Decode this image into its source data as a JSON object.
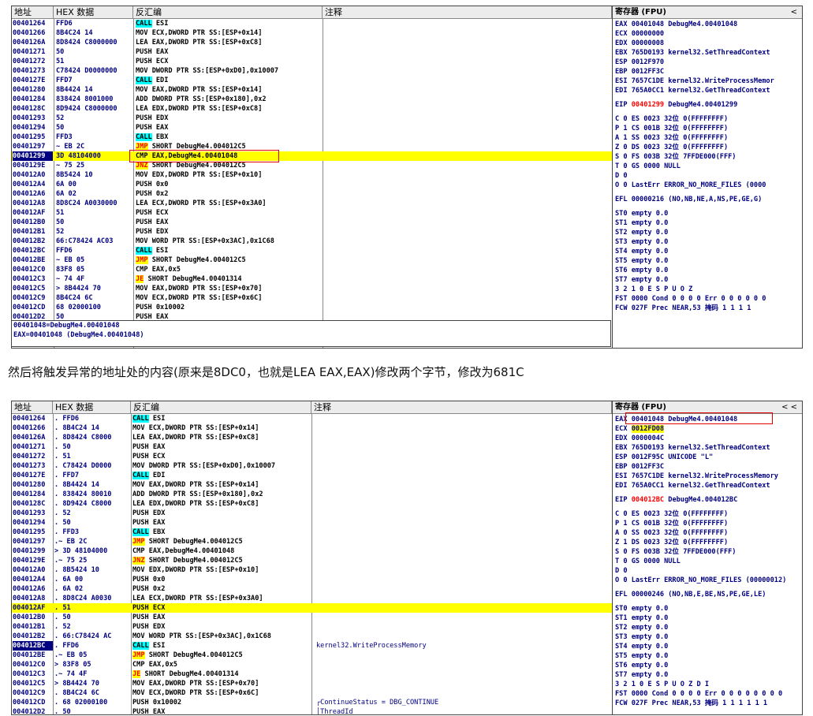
{
  "top": {
    "headers": {
      "addr": "地址",
      "hex": "HEX 数据",
      "dis": "反汇编",
      "cmt": "注释"
    },
    "rows": [
      {
        "addr": "00401264",
        "hex": "FFD6",
        "kw": "CALL",
        "kind": "call",
        "rest": " ESI",
        "cmt": ""
      },
      {
        "addr": "00401266",
        "hex": "8B4C24 14",
        "kw": "",
        "kind": "",
        "rest": "MOV ECX,DWORD PTR SS:[ESP+0x14]",
        "cmt": ""
      },
      {
        "addr": "0040126A",
        "hex": "8D8424 C8000000",
        "kw": "",
        "kind": "",
        "rest": "LEA EAX,DWORD PTR SS:[ESP+0xC8]",
        "cmt": ""
      },
      {
        "addr": "00401271",
        "hex": "50",
        "kw": "",
        "kind": "",
        "rest": "PUSH EAX",
        "cmt": ""
      },
      {
        "addr": "00401272",
        "hex": "51",
        "kw": "",
        "kind": "",
        "rest": "PUSH ECX",
        "cmt": ""
      },
      {
        "addr": "00401273",
        "hex": "C78424 D0000000",
        "kw": "",
        "kind": "",
        "rest": "MOV DWORD PTR SS:[ESP+0xD0],0x10007",
        "cmt": ""
      },
      {
        "addr": "0040127E",
        "hex": "FFD7",
        "kw": "CALL",
        "kind": "call",
        "rest": " EDI",
        "cmt": ""
      },
      {
        "addr": "00401280",
        "hex": "8B4424 14",
        "kw": "",
        "kind": "",
        "rest": "MOV EAX,DWORD PTR SS:[ESP+0x14]",
        "cmt": ""
      },
      {
        "addr": "00401284",
        "hex": "838424 8001000",
        "kw": "",
        "kind": "",
        "rest": "ADD DWORD PTR SS:[ESP+0x180],0x2",
        "cmt": ""
      },
      {
        "addr": "0040128C",
        "hex": "8D9424 C8000000",
        "kw": "",
        "kind": "",
        "rest": "LEA EDX,DWORD PTR SS:[ESP+0xC8]",
        "cmt": ""
      },
      {
        "addr": "00401293",
        "hex": "52",
        "kw": "",
        "kind": "",
        "rest": "PUSH EDX",
        "cmt": ""
      },
      {
        "addr": "00401294",
        "hex": "50",
        "kw": "",
        "kind": "",
        "rest": "PUSH EAX",
        "cmt": ""
      },
      {
        "addr": "00401295",
        "hex": "FFD3",
        "kw": "CALL",
        "kind": "call",
        "rest": " EBX",
        "cmt": ""
      },
      {
        "addr": "00401297",
        "hex": "~ EB 2C",
        "kw": "JMP",
        "kind": "jmp",
        "rest": " SHORT DebugMe4.004012C5",
        "cmt": ""
      },
      {
        "addr": "00401299",
        "hex": "3D 48104000",
        "kw": "",
        "kind": "",
        "rest": "CMP EAX,DebugMe4.00401048",
        "cmt": "",
        "hl": true,
        "sel": true
      },
      {
        "addr": "0040129E",
        "hex": "~ 75 25",
        "kw": "JNZ",
        "kind": "jcc",
        "rest": " SHORT DebugMe4.004012C5",
        "cmt": ""
      },
      {
        "addr": "004012A0",
        "hex": "8B5424 10",
        "kw": "",
        "kind": "",
        "rest": "MOV EDX,DWORD PTR SS:[ESP+0x10]",
        "cmt": ""
      },
      {
        "addr": "004012A4",
        "hex": "6A 00",
        "kw": "",
        "kind": "",
        "rest": "PUSH 0x0",
        "cmt": ""
      },
      {
        "addr": "004012A6",
        "hex": "6A 02",
        "kw": "",
        "kind": "",
        "rest": "PUSH 0x2",
        "cmt": ""
      },
      {
        "addr": "004012A8",
        "hex": "8D8C24 A0030000",
        "kw": "",
        "kind": "",
        "rest": "LEA ECX,DWORD PTR SS:[ESP+0x3A0]",
        "cmt": ""
      },
      {
        "addr": "004012AF",
        "hex": "51",
        "kw": "",
        "kind": "",
        "rest": "PUSH ECX",
        "cmt": ""
      },
      {
        "addr": "004012B0",
        "hex": "50",
        "kw": "",
        "kind": "",
        "rest": "PUSH EAX",
        "cmt": ""
      },
      {
        "addr": "004012B1",
        "hex": "52",
        "kw": "",
        "kind": "",
        "rest": "PUSH EDX",
        "cmt": ""
      },
      {
        "addr": "004012B2",
        "hex": "66:C78424 AC03",
        "kw": "",
        "kind": "",
        "rest": "MOV WORD PTR SS:[ESP+0x3AC],0x1C68",
        "cmt": ""
      },
      {
        "addr": "004012BC",
        "hex": "FFD6",
        "kw": "CALL",
        "kind": "call",
        "rest": " ESI",
        "cmt": ""
      },
      {
        "addr": "004012BE",
        "hex": "~ EB 05",
        "kw": "JMP",
        "kind": "jmp",
        "rest": " SHORT DebugMe4.004012C5",
        "cmt": ""
      },
      {
        "addr": "004012C0",
        "hex": "83F8 05",
        "kw": "",
        "kind": "",
        "rest": "CMP EAX,0x5",
        "cmt": ""
      },
      {
        "addr": "004012C3",
        "hex": "~ 74 4F",
        "kw": "JE",
        "kind": "jcc",
        "rest": " SHORT DebugMe4.00401314",
        "cmt": ""
      },
      {
        "addr": "004012C5",
        "hex": "> 8B4424 70",
        "kw": "",
        "kind": "",
        "rest": "MOV EAX,DWORD PTR SS:[ESP+0x70]",
        "cmt": ""
      },
      {
        "addr": "004012C9",
        "hex": "8B4C24 6C",
        "kw": "",
        "kind": "",
        "rest": "MOV ECX,DWORD PTR SS:[ESP+0x6C]",
        "cmt": ""
      },
      {
        "addr": "004012CD",
        "hex": "68 02000100",
        "kw": "",
        "kind": "",
        "rest": "PUSH 0x10002",
        "cmt": ""
      },
      {
        "addr": "004012D2",
        "hex": "50",
        "kw": "",
        "kind": "",
        "rest": "PUSH EAX",
        "cmt": ""
      }
    ],
    "info": [
      "00401048=DebugMe4.00401048",
      "EAX=00401048 (DebugMe4.00401048)"
    ]
  },
  "caption": "然后将触发异常的地址处的内容(原来是8DC0，也就是LEA EAX,EAX)修改两个字节，修改为681C",
  "bottom": {
    "headers": {
      "addr": "地址",
      "hex": "HEX 数据",
      "dis": "反汇编",
      "cmt": "注释"
    },
    "rows": [
      {
        "addr": "00401264",
        "hex": ". FFD6",
        "kw": "CALL",
        "kind": "call",
        "rest": " ESI",
        "cmt": ""
      },
      {
        "addr": "00401266",
        "hex": ". 8B4C24 14",
        "kw": "",
        "kind": "",
        "rest": "MOV ECX,DWORD PTR SS:[ESP+0x14]",
        "cmt": ""
      },
      {
        "addr": "0040126A",
        "hex": ". 8D8424 C8000",
        "kw": "",
        "kind": "",
        "rest": "LEA EAX,DWORD PTR SS:[ESP+0xC8]",
        "cmt": ""
      },
      {
        "addr": "00401271",
        "hex": ". 50",
        "kw": "",
        "kind": "",
        "rest": "PUSH EAX",
        "cmt": ""
      },
      {
        "addr": "00401272",
        "hex": ". 51",
        "kw": "",
        "kind": "",
        "rest": "PUSH ECX",
        "cmt": ""
      },
      {
        "addr": "00401273",
        "hex": ". C78424 D0000",
        "kw": "",
        "kind": "",
        "rest": "MOV DWORD PTR SS:[ESP+0xD0],0x10007",
        "cmt": ""
      },
      {
        "addr": "0040127E",
        "hex": ". FFD7",
        "kw": "CALL",
        "kind": "call",
        "rest": " EDI",
        "cmt": ""
      },
      {
        "addr": "00401280",
        "hex": ". 8B4424 14",
        "kw": "",
        "kind": "",
        "rest": "MOV EAX,DWORD PTR SS:[ESP+0x14]",
        "cmt": ""
      },
      {
        "addr": "00401284",
        "hex": ". 838424 80010",
        "kw": "",
        "kind": "",
        "rest": "ADD DWORD PTR SS:[ESP+0x180],0x2",
        "cmt": ""
      },
      {
        "addr": "0040128C",
        "hex": ". 8D9424 C8000",
        "kw": "",
        "kind": "",
        "rest": "LEA EDX,DWORD PTR SS:[ESP+0xC8]",
        "cmt": ""
      },
      {
        "addr": "00401293",
        "hex": ". 52",
        "kw": "",
        "kind": "",
        "rest": "PUSH EDX",
        "cmt": ""
      },
      {
        "addr": "00401294",
        "hex": ". 50",
        "kw": "",
        "kind": "",
        "rest": "PUSH EAX",
        "cmt": ""
      },
      {
        "addr": "00401295",
        "hex": ". FFD3",
        "kw": "CALL",
        "kind": "call",
        "rest": " EBX",
        "cmt": ""
      },
      {
        "addr": "00401297",
        "hex": ".~ EB 2C",
        "kw": "JMP",
        "kind": "jmp",
        "rest": " SHORT DebugMe4.004012C5",
        "cmt": ""
      },
      {
        "addr": "00401299",
        "hex": "> 3D 48104000",
        "kw": "",
        "kind": "",
        "rest": "CMP EAX,DebugMe4.00401048",
        "cmt": ""
      },
      {
        "addr": "0040129E",
        "hex": ".~ 75 25",
        "kw": "JNZ",
        "kind": "jcc",
        "rest": " SHORT DebugMe4.004012C5",
        "cmt": ""
      },
      {
        "addr": "004012A0",
        "hex": ". 8B5424 10",
        "kw": "",
        "kind": "",
        "rest": "MOV EDX,DWORD PTR SS:[ESP+0x10]",
        "cmt": ""
      },
      {
        "addr": "004012A4",
        "hex": ". 6A 00",
        "kw": "",
        "kind": "",
        "rest": "PUSH 0x0",
        "cmt": ""
      },
      {
        "addr": "004012A6",
        "hex": ". 6A 02",
        "kw": "",
        "kind": "",
        "rest": "PUSH 0x2",
        "cmt": ""
      },
      {
        "addr": "004012A8",
        "hex": ". 8D8C24 A0030",
        "kw": "",
        "kind": "",
        "rest": "LEA ECX,DWORD PTR SS:[ESP+0x3A0]",
        "cmt": ""
      },
      {
        "addr": "004012AF",
        "hex": ". 51",
        "kw": "",
        "kind": "",
        "rest": "PUSH ECX",
        "cmt": "",
        "hl": true,
        "sel": true
      },
      {
        "addr": "004012B0",
        "hex": ". 50",
        "kw": "",
        "kind": "",
        "rest": "PUSH EAX",
        "cmt": ""
      },
      {
        "addr": "004012B1",
        "hex": ". 52",
        "kw": "",
        "kind": "",
        "rest": "PUSH EDX",
        "cmt": ""
      },
      {
        "addr": "004012B2",
        "hex": ". 66:C78424 AC",
        "kw": "",
        "kind": "",
        "rest": "MOV WORD PTR SS:[ESP+0x3AC],0x1C68",
        "cmt": ""
      },
      {
        "addr": "004012BC",
        "hex": ". FFD6",
        "kw": "CALL",
        "kind": "call",
        "rest": " ESI",
        "cmt": "kernel32.WriteProcessMemory",
        "sel2": true
      },
      {
        "addr": "004012BE",
        "hex": ".~ EB 05",
        "kw": "JMP",
        "kind": "jmp",
        "rest": " SHORT DebugMe4.004012C5",
        "cmt": ""
      },
      {
        "addr": "004012C0",
        "hex": "> 83F8 05",
        "kw": "",
        "kind": "",
        "rest": "CMP EAX,0x5",
        "cmt": ""
      },
      {
        "addr": "004012C3",
        "hex": ".~ 74 4F",
        "kw": "JE",
        "kind": "jcc",
        "rest": " SHORT DebugMe4.00401314",
        "cmt": ""
      },
      {
        "addr": "004012C5",
        "hex": "> 8B4424 70",
        "kw": "",
        "kind": "",
        "rest": "MOV EAX,DWORD PTR SS:[ESP+0x70]",
        "cmt": ""
      },
      {
        "addr": "004012C9",
        "hex": ". 8B4C24 6C",
        "kw": "",
        "kind": "",
        "rest": "MOV ECX,DWORD PTR SS:[ESP+0x6C]",
        "cmt": ""
      },
      {
        "addr": "004012CD",
        "hex": ". 68 02000100",
        "kw": "",
        "kind": "",
        "rest": "PUSH 0x10002",
        "cmt": "┌ContinueStatus = DBG_CONTINUE"
      },
      {
        "addr": "004012D2",
        "hex": ". 50",
        "kw": "",
        "kind": "",
        "rest": "PUSH EAX",
        "cmt": "│ThreadId"
      }
    ]
  },
  "regs_top": {
    "title": "寄存器 (FPU)",
    "arrows": "<",
    "lines": [
      "EAX 00401048 DebugMe4.00401048",
      "ECX 00000000",
      "EDX 00000008",
      "EBX 765D0193 kernel32.SetThreadContext",
      "ESP 0012F970",
      "EBP 0012FF3C",
      "ESI 7657C1DE kernel32.WriteProcessMemor",
      "EDI 765A0CC1 kernel32.GetThreadContext",
      "",
      "EIP 00401299 DebugMe4.00401299",
      "",
      "C 0  ES 0023 32位 0(FFFFFFFF)",
      "P 1  CS 001B 32位 0(FFFFFFFF)",
      "A 1  SS 0023 32位 0(FFFFFFFF)",
      "Z 0  DS 0023 32位 0(FFFFFFFF)",
      "S 0  FS 003B 32位 7FFDE000(FFF)",
      "T 0  GS 0000 NULL",
      "D 0",
      "O 0  LastErr ERROR_NO_MORE_FILES (0000",
      "",
      "EFL 00000216 (NO,NB,NE,A,NS,PE,GE,G)",
      "",
      "ST0 empty 0.0",
      "ST1 empty 0.0",
      "ST2 empty 0.0",
      "ST3 empty 0.0",
      "ST4 empty 0.0",
      "ST5 empty 0.0",
      "ST6 empty 0.0",
      "ST7 empty 0.0",
      "              3 2 1 0      E S P U O Z",
      "FST 0000  Cond 0 0 0 0  Err 0 0 0 0 0 0",
      "FCW 027F  Prec NEAR,53  掩码    1 1 1 1"
    ]
  },
  "regs_bottom": {
    "title": "寄存器 (FPU)",
    "arrows": "<   <",
    "lines": [
      "EAX 00401048 DebugMe4.00401048",
      "ECX 0012FD08",
      "EDX 0000004C",
      "EBX 765D0193 kernel32.SetThreadContext",
      "ESP 0012F95C UNICODE \"L\"",
      "EBP 0012FF3C",
      "ESI 7657C1DE kernel32.WriteProcessMemory",
      "EDI 765A0CC1 kernel32.GetThreadContext",
      "",
      "EIP 004012BC DebugMe4.004012BC",
      "",
      "C 0  ES 0023 32位 0(FFFFFFFF)",
      "P 1  CS 001B 32位 0(FFFFFFFF)",
      "A 0  SS 0023 32位 0(FFFFFFFF)",
      "Z 1  DS 0023 32位 0(FFFFFFFF)",
      "S 0  FS 003B 32位 7FFDE000(FFF)",
      "T 0  GS 0000 NULL",
      "D 0",
      "O 0  LastErr ERROR_NO_MORE_FILES (00000012)",
      "",
      "EFL 00000246 (NO,NB,E,BE,NS,PE,GE,LE)",
      "",
      "ST0 empty 0.0",
      "ST1 empty 0.0",
      "ST2 empty 0.0",
      "ST3 empty 0.0",
      "ST4 empty 0.0",
      "ST5 empty 0.0",
      "ST6 empty 0.0",
      "ST7 empty 0.0",
      "              3 2 1 0      E S P U O Z D I",
      "FST 0000  Cond 0 0 0 0  Err 0 0 0 0 0 0 0 0",
      "FCW 027F  Prec NEAR,53  掩码    1 1 1 1 1 1"
    ]
  }
}
